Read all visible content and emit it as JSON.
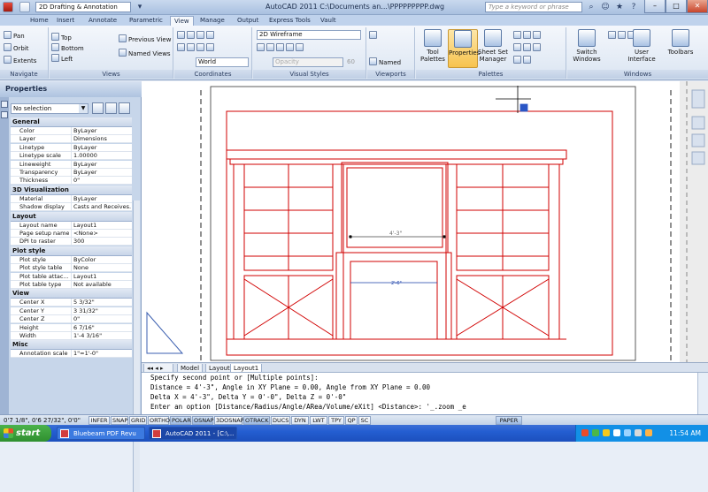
{
  "window": {
    "workspace": "2D Drafting & Annotation",
    "title": "AutoCAD 2011    C:\\Documents an...\\PPPPPPPPP.dwg",
    "search_placeholder": "Type a keyword or phrase"
  },
  "ribbon_tabs": [
    "Home",
    "Insert",
    "Annotate",
    "Parametric",
    "View",
    "Manage",
    "Output",
    "Express Tools",
    "Vault"
  ],
  "ribbon": {
    "navigate": {
      "title": "Navigate",
      "pan": "Pan",
      "orbit": "Orbit",
      "extents": "Extents"
    },
    "views": {
      "title": "Views",
      "top": "Top",
      "bottom": "Bottom",
      "left": "Left",
      "previous": "Previous View",
      "named": "Named Views"
    },
    "coordinates": {
      "title": "Coordinates",
      "ucs": "World"
    },
    "visual_styles": {
      "title": "Visual Styles",
      "style": "2D Wireframe",
      "opacity_label": "Opacity",
      "opacity_value": "60"
    },
    "viewports": {
      "title": "Viewports",
      "named": "Named"
    },
    "palettes": {
      "title": "Palettes",
      "tool": "Tool Palettes",
      "properties": "Properties",
      "sheetset": "Sheet Set Manager"
    },
    "windows": {
      "title": "Windows",
      "switch": "Switch Windows",
      "ui": "User Interface",
      "toolbars": "Toolbars"
    }
  },
  "properties_palette": {
    "title": "Properties",
    "selection": "No selection",
    "sections": [
      {
        "name": "General",
        "rows": [
          [
            "Color",
            "ByLayer"
          ],
          [
            "Layer",
            "Dimensions"
          ],
          [
            "Linetype",
            "ByLayer"
          ],
          [
            "Linetype scale",
            "1.00000"
          ],
          [
            "Lineweight",
            "ByLayer"
          ],
          [
            "Transparency",
            "ByLayer"
          ],
          [
            "Thickness",
            "0\""
          ]
        ]
      },
      {
        "name": "3D Visualization",
        "rows": [
          [
            "Material",
            "ByLayer"
          ],
          [
            "Shadow display",
            "Casts and Receives..."
          ]
        ]
      },
      {
        "name": "Layout",
        "rows": [
          [
            "Layout name",
            "Layout1"
          ],
          [
            "Page setup name",
            "<None>"
          ],
          [
            "DPI to raster",
            "300"
          ]
        ]
      },
      {
        "name": "Plot style",
        "rows": [
          [
            "Plot style",
            "ByColor"
          ],
          [
            "Plot style table",
            "None"
          ],
          [
            "Plot table attac...",
            "Layout1"
          ],
          [
            "Plot table type",
            "Not available"
          ]
        ]
      },
      {
        "name": "View",
        "rows": [
          [
            "Center X",
            "5 3/32\""
          ],
          [
            "Center Y",
            "3 31/32\""
          ],
          [
            "Center Z",
            "0\""
          ],
          [
            "Height",
            "6 7/16\""
          ],
          [
            "Width",
            "1'-4 3/16\""
          ]
        ]
      },
      {
        "name": "Misc",
        "rows": [
          [
            "Annotation scale",
            "1\"=1'-0\""
          ]
        ]
      }
    ]
  },
  "drawing": {
    "dim_label": "4'-3\"",
    "dim_label2": "2'-6\""
  },
  "layout_tabs": [
    "Model",
    "Layout",
    "Layout1"
  ],
  "command_lines": [
    "Specify second point or [Multiple points]:",
    "Distance = 4'-3\",  Angle in XY Plane = 0.00,  Angle from XY Plane = 0.00",
    "Delta X = 4'-3\",  Delta Y = 0'-0\",    Delta Z = 0'-0\"",
    "Enter an option [Distance/Radius/Angle/ARea/Volume/eXit] <Distance>: '_.zoom _e"
  ],
  "status": {
    "coords": "0'7 1/8\",  0'6 27/32\", 0'0\"",
    "buttons": [
      "INFER",
      "SNAP",
      "GRID",
      "ORTHO",
      "POLAR",
      "OSNAP",
      "3DOSNAP",
      "OTRACK",
      "DUCS",
      "DYN",
      "LWT",
      "TPY",
      "QP",
      "SC"
    ],
    "paper": "PAPER"
  },
  "taskbar": {
    "start": "start",
    "tasks": [
      "Bluebeam PDF Revu",
      "AutoCAD 2011 - [C:\\..."
    ],
    "clock": "11:54 AM"
  },
  "colors": {
    "accent": "#d10000",
    "ribbon": "#dbe5f2",
    "taskbar": "#245ed1"
  }
}
